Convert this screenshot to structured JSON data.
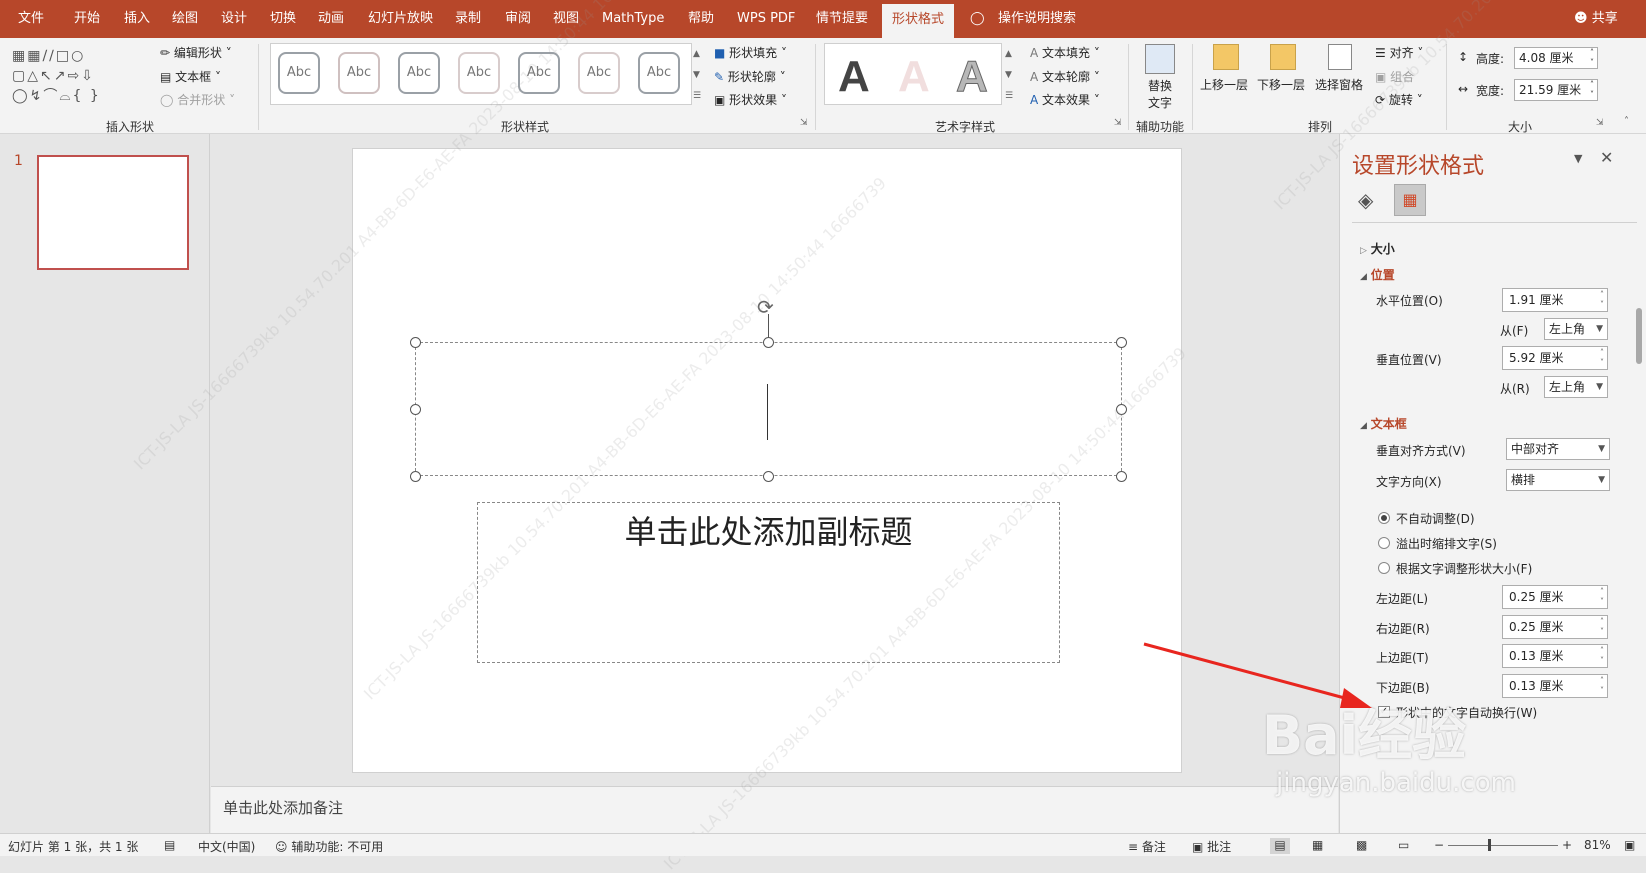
{
  "menubar": {
    "tabs": [
      "文件",
      "开始",
      "插入",
      "绘图",
      "设计",
      "切换",
      "动画",
      "幻灯片放映",
      "录制",
      "审阅",
      "视图",
      "MathType",
      "帮助",
      "WPS PDF",
      "情节提要",
      "形状格式"
    ],
    "active_tab": "形状格式",
    "search": "操作说明搜索",
    "share": "共享"
  },
  "ribbon": {
    "insert_shapes": {
      "edit_shape": "编辑形状",
      "text_box": "文本框",
      "merge_shapes": "合并形状",
      "label": "插入形状"
    },
    "shape_styles": {
      "swatch_text": "Abc",
      "fill": "形状填充",
      "outline": "形状轮廓",
      "effects": "形状效果",
      "label": "形状样式"
    },
    "wordart": {
      "letter": "A",
      "text_fill": "文本填充",
      "text_outline": "文本轮廓",
      "text_effects": "文本效果",
      "label": "艺术字样式"
    },
    "accessibility": {
      "alt_text_1": "替换",
      "alt_text_2": "文字",
      "label": "辅助功能"
    },
    "arrange": {
      "bring_forward": "上移一层",
      "send_backward": "下移一层",
      "selection_pane": "选择窗格",
      "align": "对齐",
      "group": "组合",
      "rotate": "旋转",
      "label": "排列"
    },
    "size": {
      "height_label": "高度:",
      "height_value": "4.08 厘米",
      "width_label": "宽度:",
      "width_value": "21.59 厘米",
      "label": "大小"
    }
  },
  "thumbnails": {
    "slide_number": "1"
  },
  "slide": {
    "subtitle_placeholder": "单击此处添加副标题"
  },
  "notes": {
    "placeholder": "单击此处添加备注"
  },
  "panel": {
    "title": "设置形状格式",
    "section_size": "大小",
    "section_position": "位置",
    "horizontal_label": "水平位置(O)",
    "horizontal_value": "1.91 厘米",
    "from_label": "从(F)",
    "from_value": "左上角",
    "vertical_label": "垂直位置(V)",
    "vertical_value": "5.92 厘米",
    "from_label2": "从(R)",
    "from_value2": "左上角",
    "section_textbox": "文本框",
    "valign_label": "垂直对齐方式(V)",
    "valign_value": "中部对齐",
    "textdir_label": "文字方向(X)",
    "textdir_value": "横排",
    "radio_noautofit": "不自动调整(D)",
    "radio_shrink": "溢出时缩排文字(S)",
    "radio_resize": "根据文字调整形状大小(F)",
    "left_margin_label": "左边距(L)",
    "left_margin_value": "0.25 厘米",
    "right_margin_label": "右边距(R)",
    "right_margin_value": "0.25 厘米",
    "top_margin_label": "上边距(T)",
    "top_margin_value": "0.13 厘米",
    "bottom_margin_label": "下边距(B)",
    "bottom_margin_value": "0.13 厘米",
    "wrap_label": "形状中的文字自动换行(W)"
  },
  "status": {
    "slide_info": "幻灯片 第 1 张，共 1 张",
    "language": "中文(中国)",
    "accessibility": "辅助功能: 不可用",
    "notes": "备注",
    "comments": "批注",
    "zoom": "81%"
  },
  "watermarks": [
    "ICT-JS-LA  JS-16666739kb  10.54.70.201  A4-BB-6D-E6-AE-FA  2023-08-10  14:50:44  16666739"
  ],
  "baidu": {
    "logo": "Bai经验",
    "url": "jingyan.baidu.com"
  },
  "colors": {
    "accent": "#b7472a",
    "arrow": "#e8261f"
  }
}
